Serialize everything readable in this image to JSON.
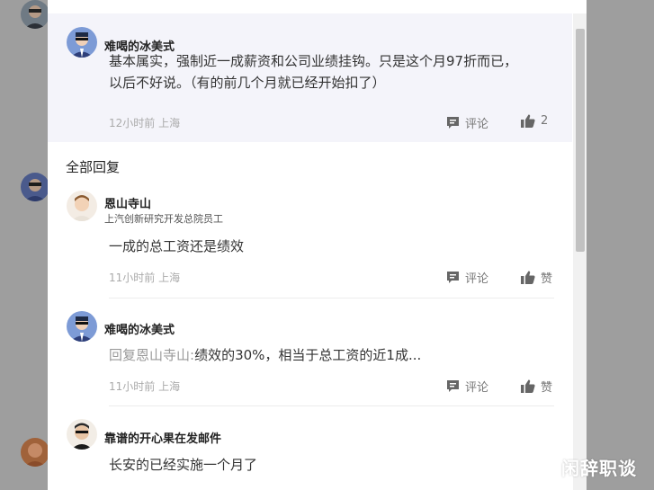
{
  "main_comment": {
    "username": "难喝的冰美式",
    "text_line1": "基本属实，强制近一成薪资和公司业绩挂钩。只是这个月97折而已，",
    "text_line2": "以后不好说。（有的前几个月就已经开始扣了）",
    "meta": "12小时前 上海",
    "comment_label": "评论",
    "like_count": "2"
  },
  "replies_title": "全部回复",
  "replies": [
    {
      "username": "恩山寺山",
      "subtitle": "上汽创新研究开发总院员工",
      "text": "一成的总工资还是绩效",
      "meta": "11小时前 上海",
      "comment_label": "评论",
      "like_label": "赞"
    },
    {
      "username": "难喝的冰美式",
      "reply_prefix": "回复恩山寺山:",
      "text": "绩效的30%，相当于总工资的近1成...",
      "meta": "11小时前 上海",
      "comment_label": "评论",
      "like_label": "赞"
    },
    {
      "username": "靠谱的开心果在发邮件",
      "text": "长安的已经实施一个月了"
    }
  ],
  "watermark": "闲辞职谈",
  "icons": {
    "comment": "comment-bubble-icon",
    "like": "thumbs-up-icon"
  },
  "colors": {
    "overlay": "#9e9e9e",
    "main_comment_bg": "#f4f4fa",
    "meta_text": "#aaaaaa",
    "reply_prefix": "#999999"
  }
}
